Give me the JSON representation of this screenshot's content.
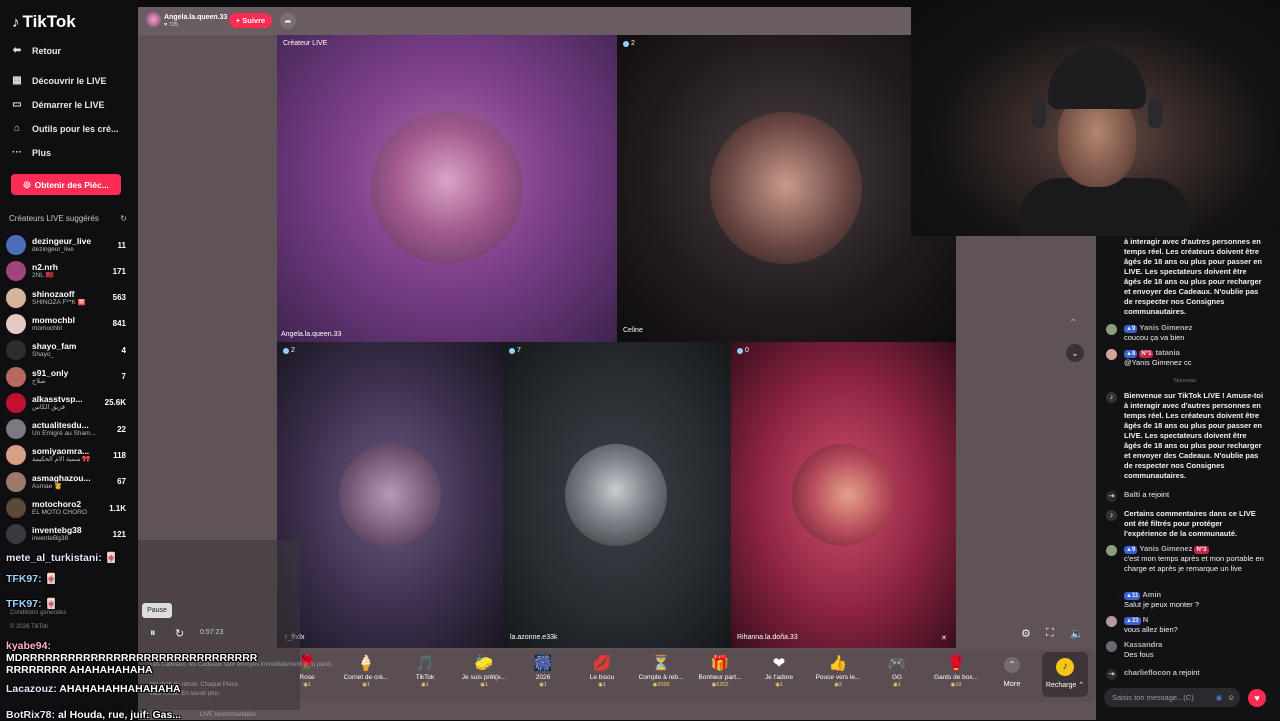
{
  "sidebar": {
    "logo": "TikTok",
    "nav": [
      {
        "label": "Retour",
        "icon": "back-arrow-icon"
      },
      {
        "label": "Découvrir le LIVE",
        "icon": "live-calendar-icon"
      },
      {
        "label": "Démarrer le LIVE",
        "icon": "video-camera-icon"
      },
      {
        "label": "Outils pour les cré...",
        "icon": "house-icon"
      },
      {
        "label": "Plus",
        "icon": "more-dots-icon"
      }
    ],
    "coins_button": "Obtenir des Pièc...",
    "suggested_title": "Créateurs LIVE suggérés",
    "suggested": [
      {
        "name": "dezingeur_live",
        "sub": "dezingeur_live",
        "count": "11",
        "color": "#4b6cb7"
      },
      {
        "name": "n2.nrh",
        "sub": "2NL 🇲🇦",
        "count": "171",
        "color": "#a0467a"
      },
      {
        "name": "shinozaoff",
        "sub": "SHINOZA F**K 🈲",
        "count": "563",
        "color": "#d8b39b"
      },
      {
        "name": "momochbl",
        "sub": "momochbl",
        "count": "841",
        "color": "#e8c9c2"
      },
      {
        "name": "shayo_fam",
        "sub": "Shayo_",
        "count": "4",
        "color": "#2e2e2e"
      },
      {
        "name": "s91_only",
        "sub": "صلاح",
        "count": "7",
        "color": "#b66a5d"
      },
      {
        "name": "alkasstvsp...",
        "sub": "فريق الكأس",
        "count": "25.6K",
        "color": "#c4102f"
      },
      {
        "name": "actualitesdu...",
        "sub": "Un Émigré au Sham...",
        "count": "22",
        "color": "#7a7a80"
      },
      {
        "name": "somiyaomra...",
        "sub": "سمية الأم الحكيمة 🎀",
        "count": "118",
        "color": "#d69f86"
      },
      {
        "name": "asmaghazou...",
        "sub": "Asmae 👸",
        "count": "67",
        "color": "#9c7b6b"
      },
      {
        "name": "motochoro2",
        "sub": "EL MOTO CHORO",
        "count": "1.1K",
        "color": "#5a4a3a"
      },
      {
        "name": "inventebg38",
        "sub": "inventeBg38",
        "count": "121",
        "color": "#3a3a40"
      }
    ]
  },
  "live": {
    "host_name": "Angela.la.queen.33",
    "host_likes": "725",
    "follow_label": "+ Suivre",
    "tiles": [
      {
        "label": "Angela.la.queen.33",
        "badge": "Créateur LIVE",
        "viewers": ""
      },
      {
        "label": "Celine",
        "badge": "",
        "viewers": "2"
      },
      {
        "label": "r_fhdx",
        "badge": "",
        "viewers": "2"
      },
      {
        "label": "la.azonne.e33k",
        "badge": "",
        "viewers": "7"
      },
      {
        "label": "Rihanna.la.doña.33",
        "badge": "",
        "viewers": "0"
      }
    ],
    "gifts": [
      {
        "name": "Rose",
        "price": "1",
        "icon": "🌹"
      },
      {
        "name": "Cornet de crè...",
        "price": "1",
        "icon": "🍦"
      },
      {
        "name": "TikTok",
        "price": "1",
        "icon": "🎵"
      },
      {
        "name": "Je suis prêt(e...",
        "price": "1",
        "icon": "🧽"
      },
      {
        "name": "2026",
        "price": "1",
        "icon": "🎆"
      },
      {
        "name": "Le bisou",
        "price": "1",
        "icon": "💋"
      },
      {
        "name": "Compte à reb...",
        "price": "2026",
        "icon": "⏳"
      },
      {
        "name": "Bonheur part...",
        "price": "6202",
        "icon": "🎁"
      },
      {
        "name": "Je t'adore",
        "price": "1",
        "icon": "❤"
      },
      {
        "name": "Pouce vers le...",
        "price": "2",
        "icon": "👍"
      },
      {
        "name": "GG",
        "price": "1",
        "icon": "🎮"
      },
      {
        "name": "Gants de box...",
        "price": "10",
        "icon": "🥊"
      }
    ],
    "more_label": "More",
    "recharge_label": "Recharge ⌃"
  },
  "chat": {
    "messages": [
      {
        "type": "system",
        "text": "à interagir avec d'autres personnes en temps réel. Les créateurs doivent être âgés de 18 ans ou plus pour passer en LIVE. Les spectateurs doivent être âgés de 18 ans ou plus pour recharger et envoyer des Cadeaux. N'oublie pas de respecter nos Consignes communautaires."
      },
      {
        "type": "user",
        "user": "Yanis Gimenez",
        "badge": "9",
        "text": "coucou ça va bien"
      },
      {
        "type": "user",
        "user": "tatania",
        "badge": "8",
        "text": "@Yanis Gimenez cc"
      },
      {
        "type": "system",
        "text": "Bienvenue sur TikTok LIVE ! Amuse-toi à interagir avec d'autres personnes en temps réel. Les créateurs doivent être âgés de 18 ans ou plus pour passer en LIVE. Les spectateurs doivent être âgés de 18 ans ou plus pour recharger et envoyer des Cadeaux. N'oublie pas de respecter nos Consignes communautaires."
      },
      {
        "type": "join",
        "user": "Balti",
        "text": "a rejoint"
      },
      {
        "type": "system",
        "text": "Certains commentaires dans ce LIVE ont été filtrés pour protéger l'expérience de la communauté."
      },
      {
        "type": "user",
        "user": "Yanis Gimenez",
        "badge": "9",
        "text": "c'est mon temps après et mon portable en charge et après je remarque un live"
      },
      {
        "type": "user",
        "user": "Amin",
        "badge": "11",
        "text": "Salut je peux monter ?"
      },
      {
        "type": "user",
        "user": "N",
        "badge": "23",
        "text": "vous allez bien?"
      },
      {
        "type": "user",
        "user": "Kassandra",
        "badge": "",
        "text": "Des fous"
      },
      {
        "type": "join",
        "user": "charlieflocon",
        "text": "a rejoint"
      }
    ],
    "separator": "Nouveau",
    "input_placeholder": "Saisis ton message...(C)"
  },
  "overlay": {
    "pause_tip": "Pause",
    "time": "0:57:23",
    "lines": [
      {
        "user": "mete_al_turkistani:",
        "text": "🀄",
        "style": "white"
      },
      {
        "user": "TFK97:",
        "text": "🀄",
        "style": "blue"
      },
      {
        "user": "TFK97:",
        "text": "🀄",
        "style": "blue"
      },
      {
        "user": "kyabe94:",
        "text": "MDRRRRRRRRRRRRRRRRRRRRRRRRRRRRRRR RRRRRRRR AHAHAHAHAHA",
        "style": "white"
      },
      {
        "user": "Lacazouz:",
        "text": "AHAHAHAHHAHAHAHA",
        "style": "white"
      },
      {
        "user": "BotRix78:",
        "text": "al Houda, rue, juif: Gas...",
        "style": "white"
      }
    ],
    "ghost": [
      "Entreprise",
      "Conditions générales",
      "© 2026 TikTok",
      "Les Cadeaux, les Cadeaux sont envoyés immédiatement et tu perds",
      "ton droit de retrait. Chaque Pièce",
      "vaut 0,01€. En savoir plus",
      "LIVE recommandées"
    ]
  }
}
